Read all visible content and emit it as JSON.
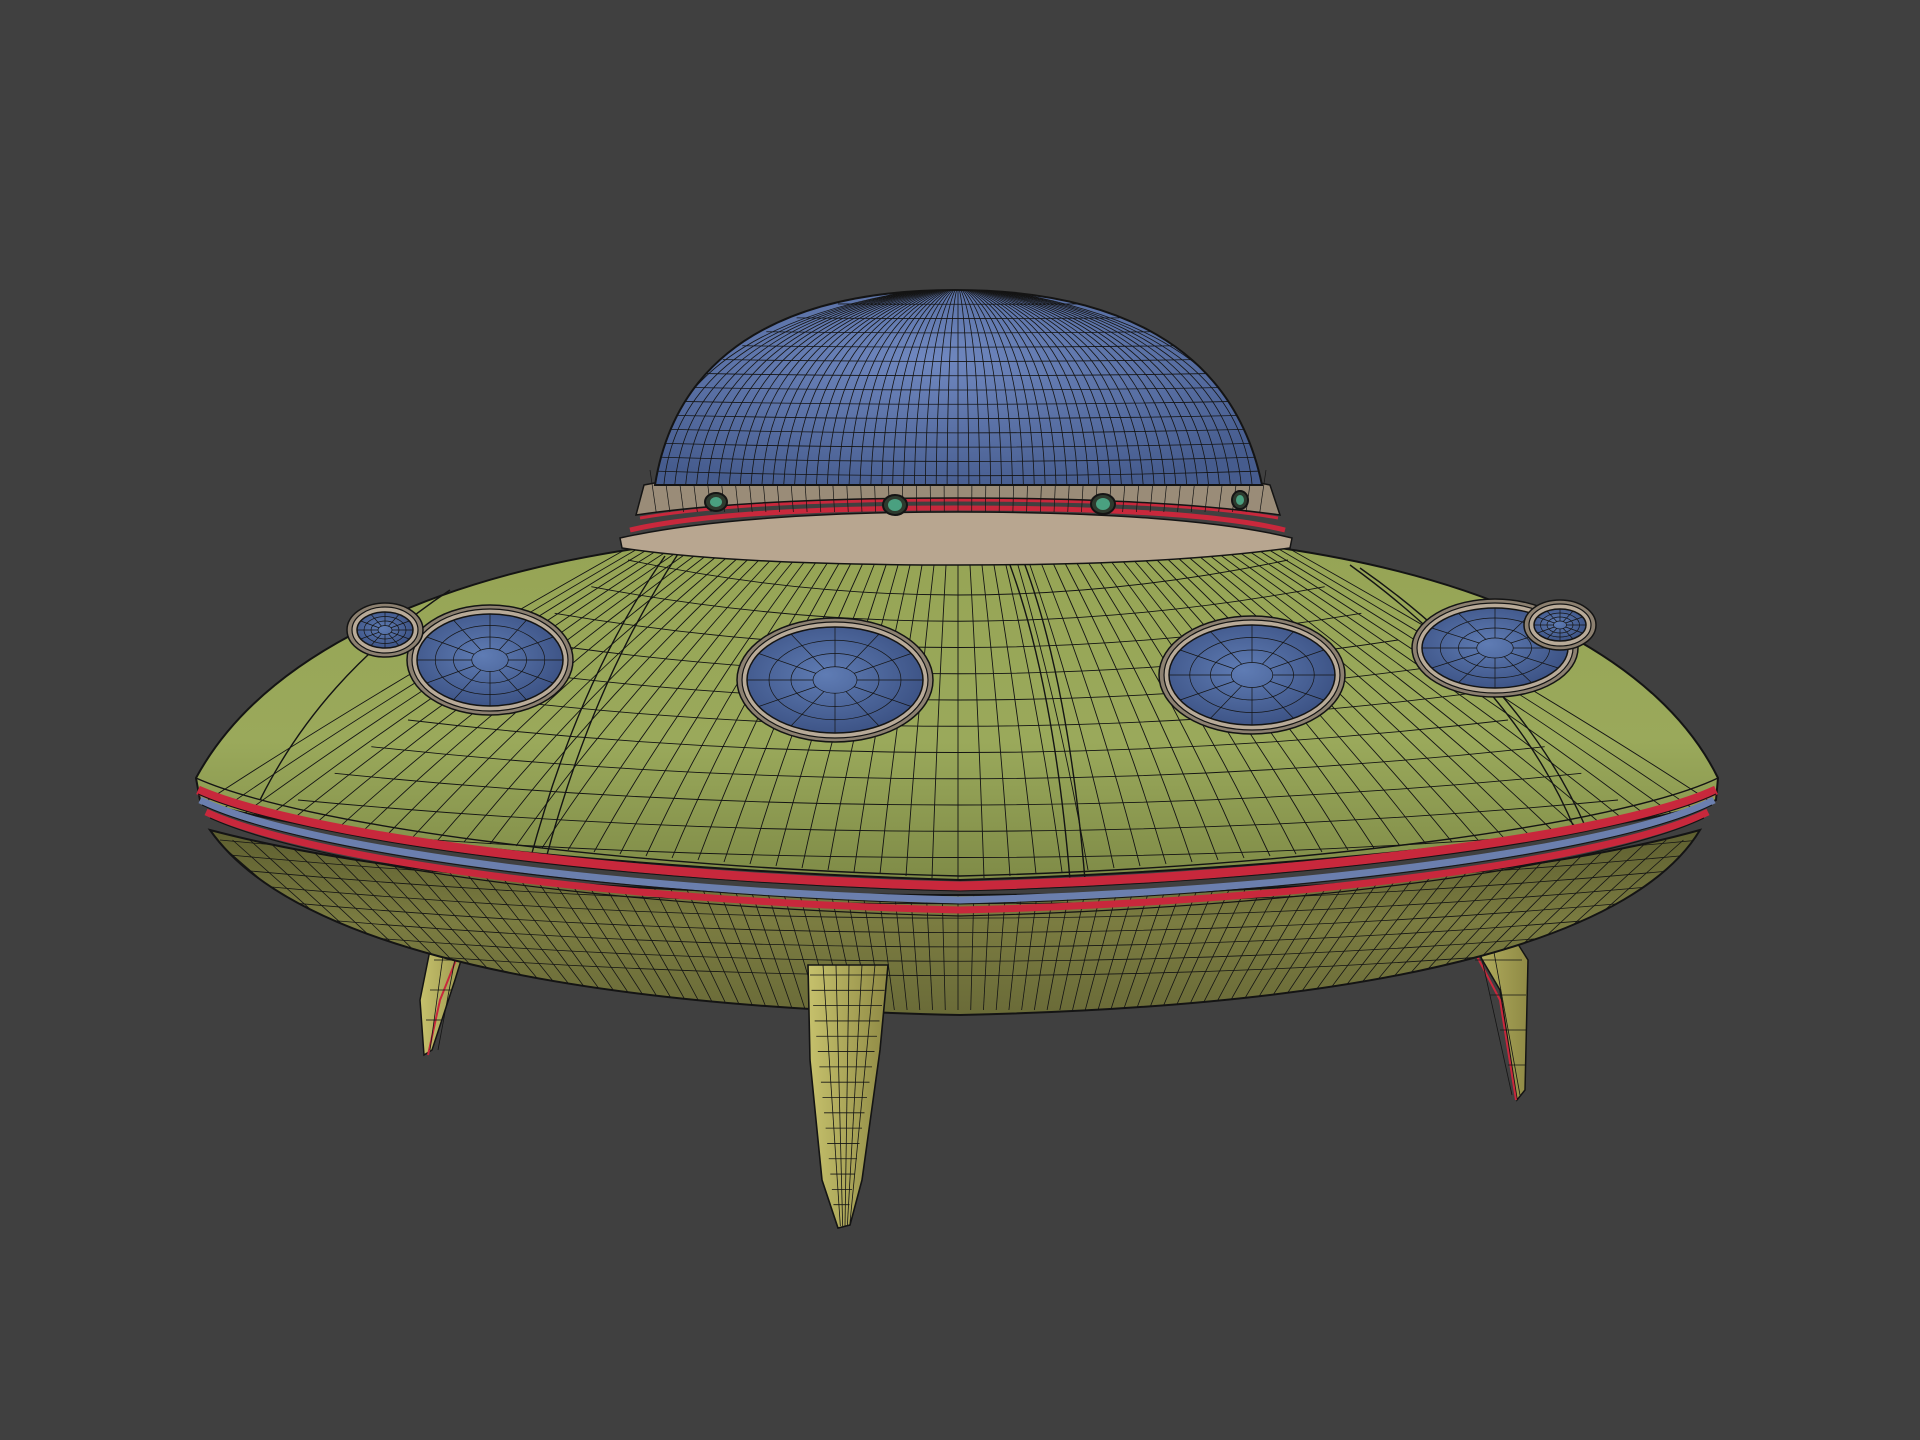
{
  "scene": {
    "background_color": "#404040",
    "subject": "ufo-wireframe-model",
    "leg_count": 4,
    "saucer_porthole_count": 6,
    "dome_light_count": 4,
    "colors": {
      "dome": "#5a73a8",
      "hull": "#8a9a4e",
      "hull_light": "#a4b05e",
      "underside": "#7a7d42",
      "legs": "#b9b460",
      "collar": "#9a8c78",
      "accent_red": "#c8283c",
      "accent_blue": "#6b7fae",
      "porthole_glass": "#4e6aa0",
      "porthole_rim": "#b8aa98",
      "wire": "#141414",
      "light_green": "#4aa080"
    }
  }
}
